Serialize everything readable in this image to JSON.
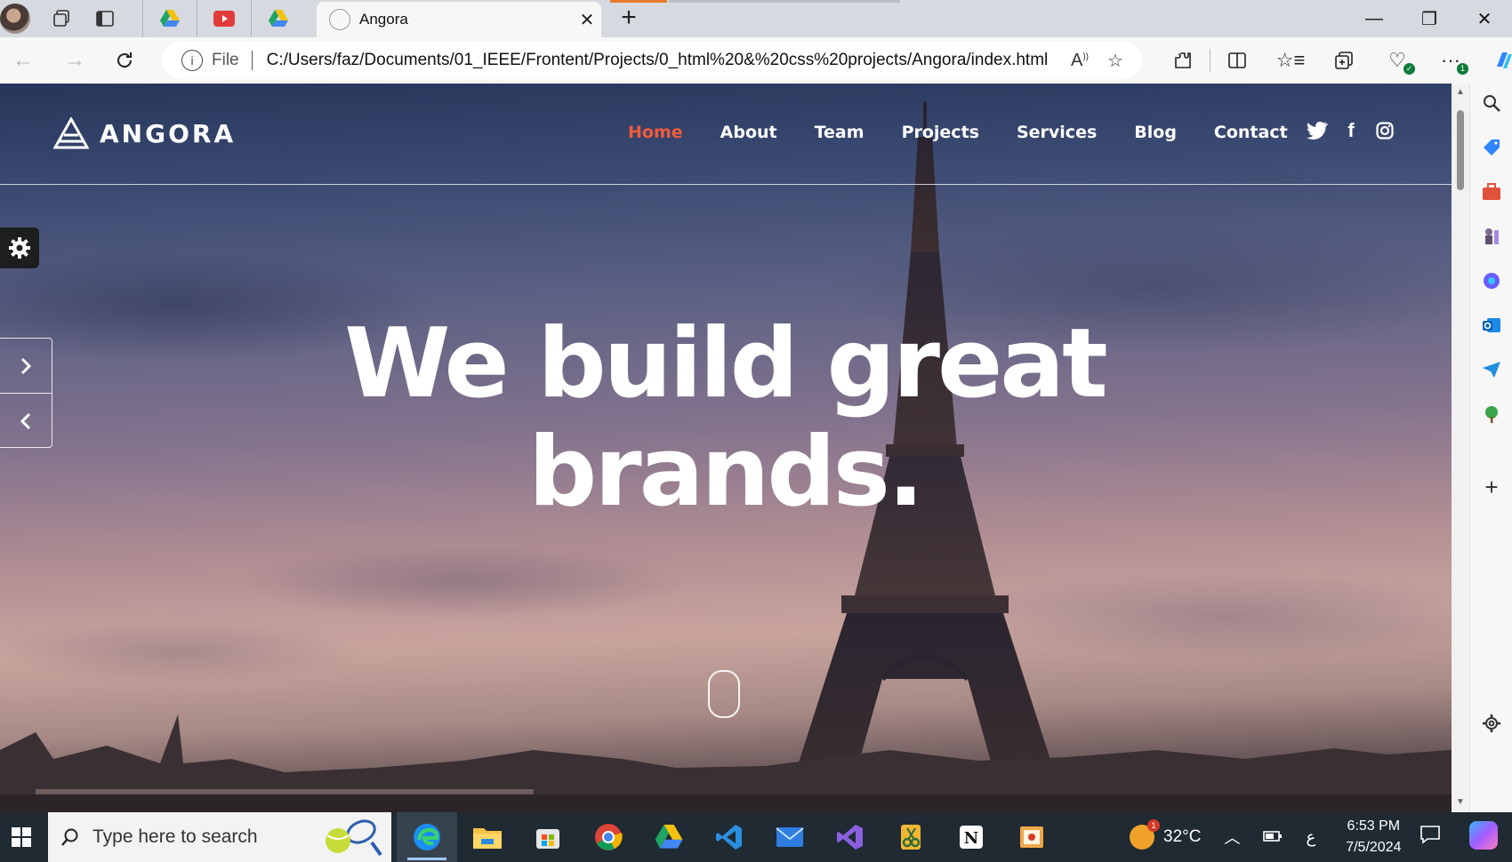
{
  "browser": {
    "tab": {
      "title": "Angora"
    },
    "new_tab_symbol": "+",
    "address": {
      "scheme": "File",
      "url": "C:/Users/faz/Documents/01_IEEE/Frontent/Projects/0_html%20&%20css%20projects/Angora/index.html"
    },
    "window_controls": [
      "—",
      "❐",
      "✕"
    ],
    "extension_badge": "1"
  },
  "site": {
    "brand": "ANGORA",
    "nav": [
      {
        "label": "Home",
        "active": true
      },
      {
        "label": "About"
      },
      {
        "label": "Team"
      },
      {
        "label": "Projects"
      },
      {
        "label": "Services"
      },
      {
        "label": "Blog"
      },
      {
        "label": "Contact"
      }
    ],
    "social": [
      "twitter-icon",
      "facebook-icon",
      "instagram-icon"
    ],
    "hero": {
      "line1": "We build great",
      "line2": "brands."
    },
    "accent_color": "#ef5a3c"
  },
  "taskbar": {
    "search_placeholder": "Type here to search",
    "weather": {
      "temp": "32°C",
      "badge": "1"
    },
    "input_lang": "ع",
    "time": "6:53 PM",
    "date": "7/5/2024"
  }
}
